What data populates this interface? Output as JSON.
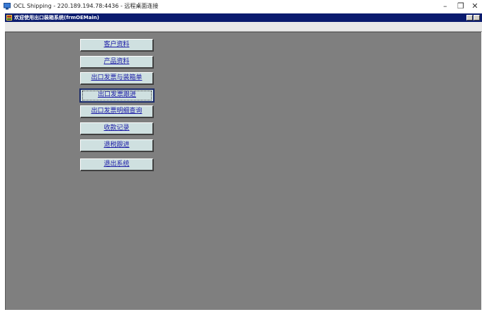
{
  "rdp_window": {
    "title": "OCL Shipping - 220.189.194.78:4436 - 远程桌面连接",
    "minimize_label": "–",
    "maximize_label": "❐",
    "close_label": "✕"
  },
  "app_window": {
    "caption": "欢迎使用出口装箱系统(frmOEMain)"
  },
  "main_menu": {
    "buttons": [
      {
        "label": "客户资料"
      },
      {
        "label": "产品资料"
      },
      {
        "label": "出口发票与装箱单"
      },
      {
        "label": "出口发票跟进"
      },
      {
        "label": "出口发票明细查询"
      },
      {
        "label": "收款记录"
      },
      {
        "label": "退税跟进"
      },
      {
        "label": "退出系统"
      }
    ],
    "focused_index": 3
  },
  "colors": {
    "client_background": "#7f7f7f",
    "caption_background": "#0a1b6e",
    "button_face": "#cfe0e0",
    "button_text": "#1a1aa6"
  }
}
